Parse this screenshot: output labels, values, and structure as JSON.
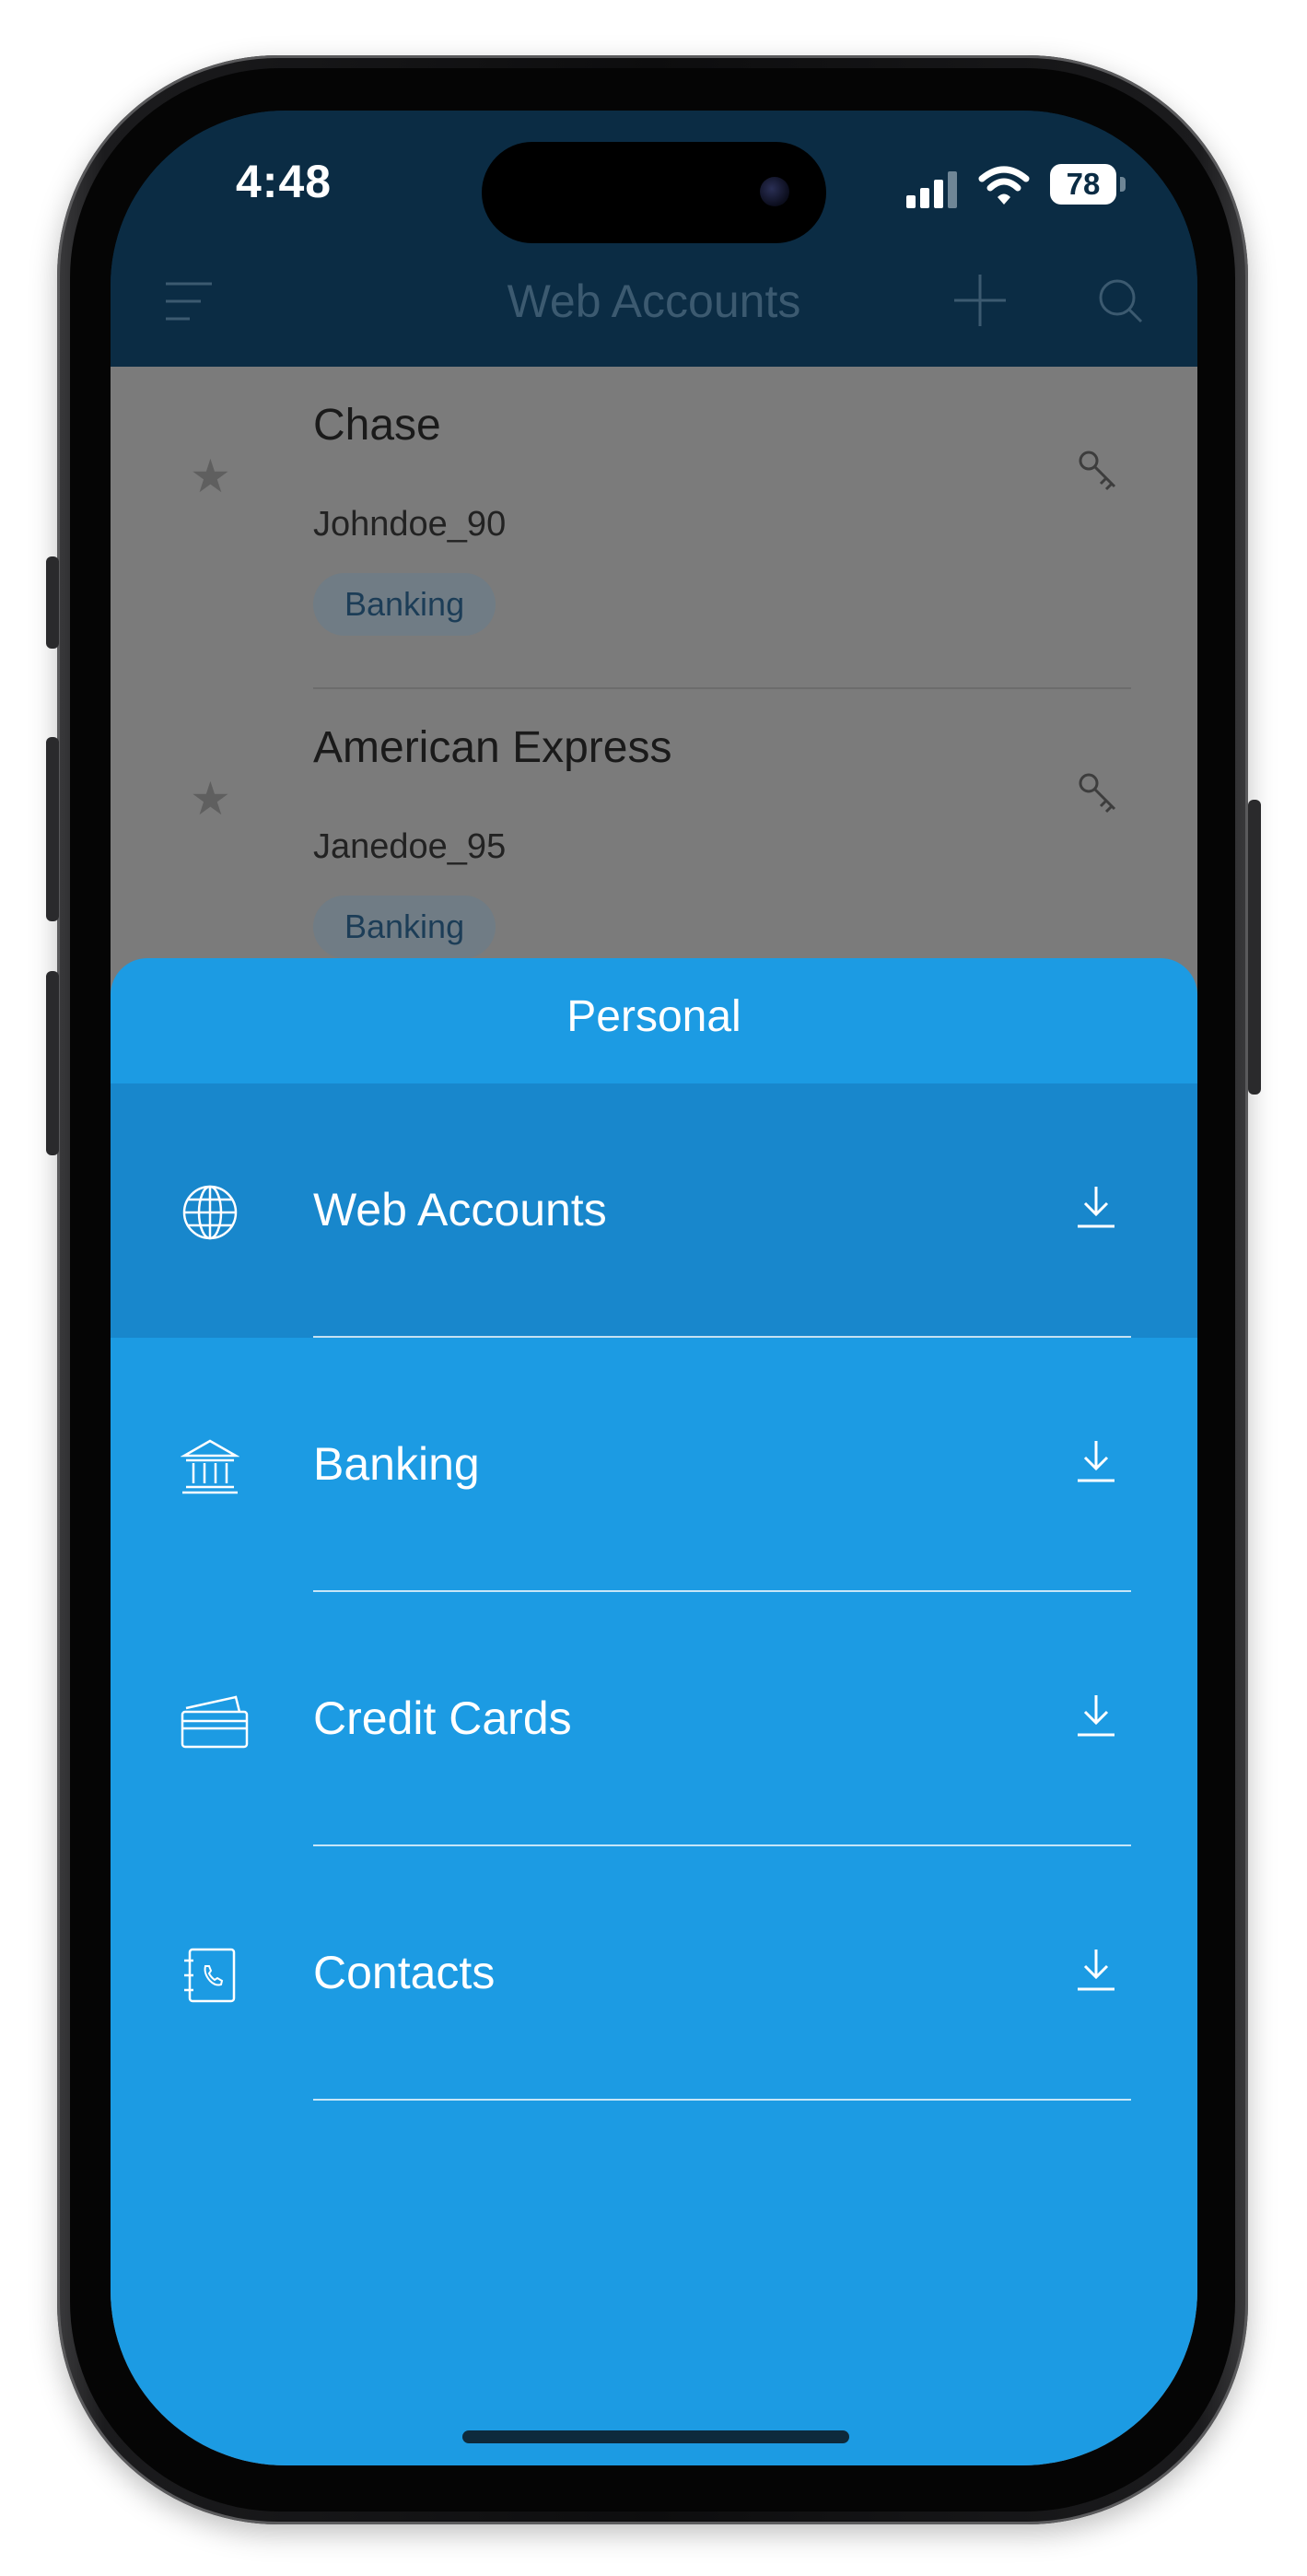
{
  "status_bar": {
    "time": "4:48",
    "battery": "78"
  },
  "header": {
    "title": "Web Accounts",
    "menu_icon": "menu-icon",
    "add_icon": "plus-icon",
    "search_icon": "search-icon"
  },
  "accounts": [
    {
      "name": "Chase",
      "username": "Johndoe_90",
      "tag": "Banking"
    },
    {
      "name": "American Express",
      "username": "Janedoe_95",
      "tag": "Banking"
    }
  ],
  "sheet": {
    "title": "Personal",
    "items": [
      {
        "label": "Web Accounts",
        "icon": "globe-icon",
        "selected": true
      },
      {
        "label": "Banking",
        "icon": "bank-icon",
        "selected": false
      },
      {
        "label": "Credit Cards",
        "icon": "credit-card-icon",
        "selected": false
      },
      {
        "label": "Contacts",
        "icon": "contacts-book-icon",
        "selected": false
      }
    ]
  },
  "colors": {
    "header_bg": "#0b2c44",
    "sheet_bg": "#1c9be3",
    "sheet_selected_bg": "#1887cc",
    "overlay_bg": "#7b7b7b"
  }
}
